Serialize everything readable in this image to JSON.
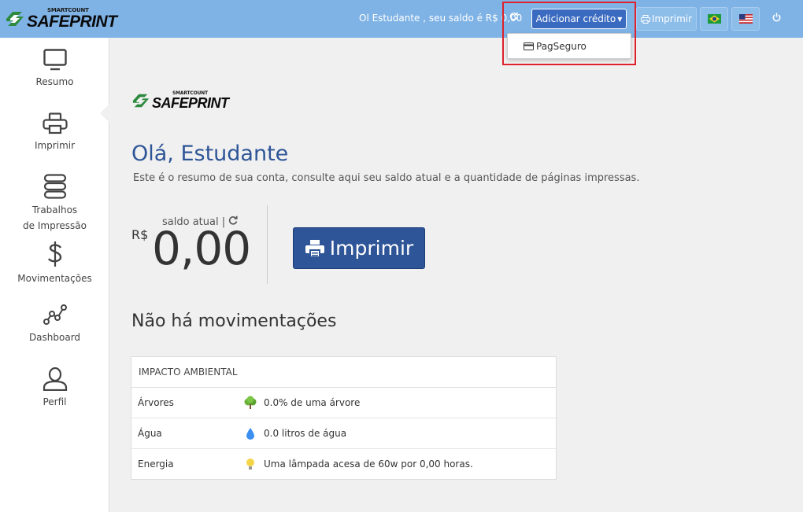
{
  "header": {
    "logo_small": "SMARTCOUNT",
    "logo_big": "SAFEPRINT",
    "greeting": "Ol Estudante , seu saldo é R$ 0,00",
    "add_credit_label": "Adicionar crédito",
    "print_label": "Imprimir",
    "accent_color": "#3a6bc0",
    "bar_color": "#7fb3e5"
  },
  "dropdown": {
    "items": [
      {
        "label": "PagSeguro",
        "icon": "credit-card-icon"
      }
    ]
  },
  "sidebar": {
    "items": [
      {
        "label": "Resumo",
        "icon": "monitor-icon"
      },
      {
        "label": "Imprimir",
        "icon": "printer-icon"
      },
      {
        "label": "Trabalhos",
        "label2": "de Impressão",
        "icon": "stack-icon"
      },
      {
        "label": "Movimentações",
        "icon": "dollar-icon"
      },
      {
        "label": "Dashboard",
        "icon": "chart-line-icon"
      },
      {
        "label": "Perfil",
        "icon": "user-icon"
      }
    ]
  },
  "main": {
    "logo_small": "SMARTCOUNT",
    "logo_big": "SAFEPRINT",
    "title": "Olá, Estudante",
    "subtitle": "Este é o resumo de sua conta, consulte aqui seu saldo atual e a quantidade de páginas impressas.",
    "currency": "R$",
    "saldo_label": "saldo atual |",
    "balance": "0,00",
    "print_button": "Imprimir",
    "no_movements": "Não há movimentações",
    "title_color": "#2e5597"
  },
  "impact": {
    "heading": "IMPACTO AMBIENTAL",
    "rows": [
      {
        "label": "Árvores",
        "value": "0.0% de uma árvore",
        "icon": "tree-icon"
      },
      {
        "label": "Água",
        "value": "0.0 litros de água",
        "icon": "water-drop-icon"
      },
      {
        "label": "Energia",
        "value": "Uma lâmpada acesa de 60w por 0,00 horas.",
        "icon": "lightbulb-icon"
      }
    ]
  }
}
